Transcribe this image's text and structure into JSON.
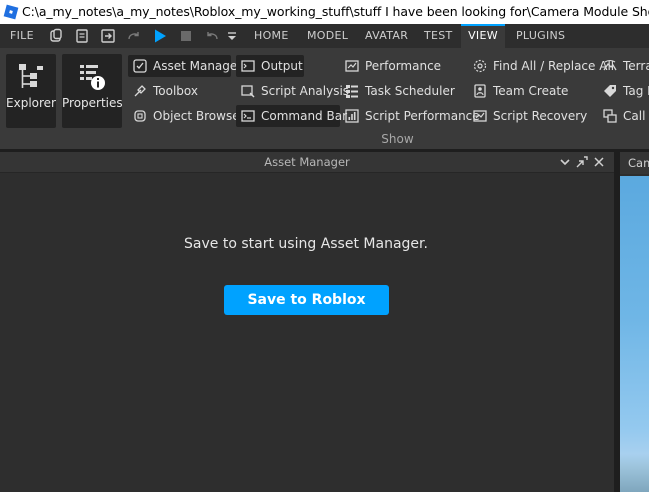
{
  "window": {
    "title": "C:\\a_my_notes\\a_my_notes\\Roblox_my_working_stuff\\stuff I have been looking for\\Camera Module Showcase puts the"
  },
  "menubar": {
    "file": "FILE",
    "tabs": [
      "HOME",
      "MODEL",
      "AVATAR",
      "TEST",
      "VIEW",
      "PLUGINS"
    ],
    "active_tab": "VIEW"
  },
  "ribbon": {
    "explorer": "Explorer",
    "properties": "Properties",
    "col1": [
      "Asset Manager",
      "Toolbox",
      "Object Browser"
    ],
    "col2": [
      "Output",
      "Script Analysis",
      "Command Bar"
    ],
    "col3": [
      "Performance",
      "Task Scheduler",
      "Script Performance"
    ],
    "col4": [
      "Find All / Replace All",
      "Team Create",
      "Script Recovery"
    ],
    "col5": [
      "Terra",
      "Tag E",
      "Call S"
    ],
    "group_label": "Show"
  },
  "asset_manager": {
    "title": "Asset Manager",
    "message": "Save to start using Asset Manager.",
    "save_button": "Save to Roblox"
  },
  "viewport": {
    "tab_label": "Cam"
  },
  "colors": {
    "accent": "#00a2ff",
    "background": "#2e2e2e",
    "ribbon": "#3a3a3a"
  }
}
